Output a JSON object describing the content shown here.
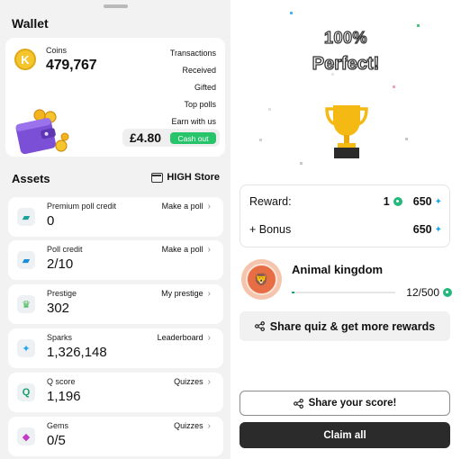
{
  "wallet": {
    "title": "Wallet",
    "coins_label": "Coins",
    "coins_value": "479,767",
    "links": [
      "Transactions",
      "Received",
      "Gifted",
      "Top polls",
      "Earn with us"
    ],
    "cash_amount": "£4.80",
    "cash_out_label": "Cash out"
  },
  "assets": {
    "title": "Assets",
    "store_label": "HIGH Store",
    "items": [
      {
        "label": "Premium poll credit",
        "value": "0",
        "link": "Make a poll",
        "icon": "ticket-icon"
      },
      {
        "label": "Poll credit",
        "value": "2/10",
        "link": "Make a poll",
        "icon": "ticket-icon"
      },
      {
        "label": "Prestige",
        "value": "302",
        "link": "My prestige",
        "icon": "crown-icon"
      },
      {
        "label": "Sparks",
        "value": "1,326,148",
        "link": "Leaderboard",
        "icon": "sparkle-icon"
      },
      {
        "label": "Q score",
        "value": "1,196",
        "link": "Quizzes",
        "icon": "q-icon"
      },
      {
        "label": "Gems",
        "value": "0/5",
        "link": "Quizzes",
        "icon": "gem-icon"
      }
    ]
  },
  "result": {
    "percent": "100%",
    "headline": "Perfect!",
    "reward_label": "Reward:",
    "reward_q": "1",
    "reward_sparks": "650",
    "bonus_label": "+ Bonus",
    "bonus_sparks": "650",
    "category": "Animal kingdom",
    "badge_text": "ANIMAL KINGDOM",
    "progress_text": "12/500",
    "progress_fraction": 0.024,
    "share_quiz_label": "Share quiz & get more rewards",
    "share_score_label": "Share your score!",
    "claim_label": "Claim all"
  },
  "colors": {
    "accent_green": "#27c46b",
    "spark_blue": "#1ea7e8",
    "trophy_gold": "#f5b913",
    "badge_orange": "#e76d44"
  }
}
